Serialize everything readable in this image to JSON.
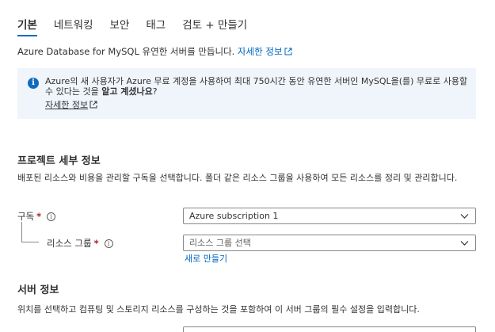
{
  "tabs": [
    {
      "label": "기본",
      "active": true
    },
    {
      "label": "네트워킹",
      "active": false
    },
    {
      "label": "보안",
      "active": false
    },
    {
      "label": "태그",
      "active": false
    },
    {
      "label": "검토 + 만들기",
      "active": false
    }
  ],
  "intro": {
    "text": "Azure Database for MySQL 유연한 서버를 만듭니다.",
    "link": "자세한 정보"
  },
  "info": {
    "text_before": "Azure의 새 사용자가 Azure 무료 계정을 사용하여 최대 750시간 동안 유연한 서버인 MySQL을(를) 무료로 사용할 수 있다는 것을",
    "text_bold": "알고 계셨나요",
    "text_after": "?",
    "link": "자세한 정보",
    "accent": "#0f6cbd",
    "background": "#f0f5fc"
  },
  "project": {
    "heading": "프로젝트 세부 정보",
    "description": "배포된 리소스와 비용을 관리할 구독을 선택합니다. 폴더 같은 리소스 그룹을 사용하여 모든 리소스를 정리 및 관리합니다.",
    "subscription_label": "구독",
    "subscription_value": "Azure subscription 1",
    "resource_group_label": "리소스 그룹",
    "resource_group_placeholder": "리소스 그룹 선택",
    "create_new_link": "새로 만들기",
    "required_mark": "*"
  },
  "server": {
    "heading": "서버 정보",
    "description": "위치를 선택하고 컴퓨팅 및 스토리지 리소스를 구성하는 것을 포함하여 이 서버 그룹의 필수 설정을 입력합니다."
  },
  "colors": {
    "link": "#0066c0",
    "required": "#a4262c",
    "tab_underline": "#0f6cbd"
  }
}
